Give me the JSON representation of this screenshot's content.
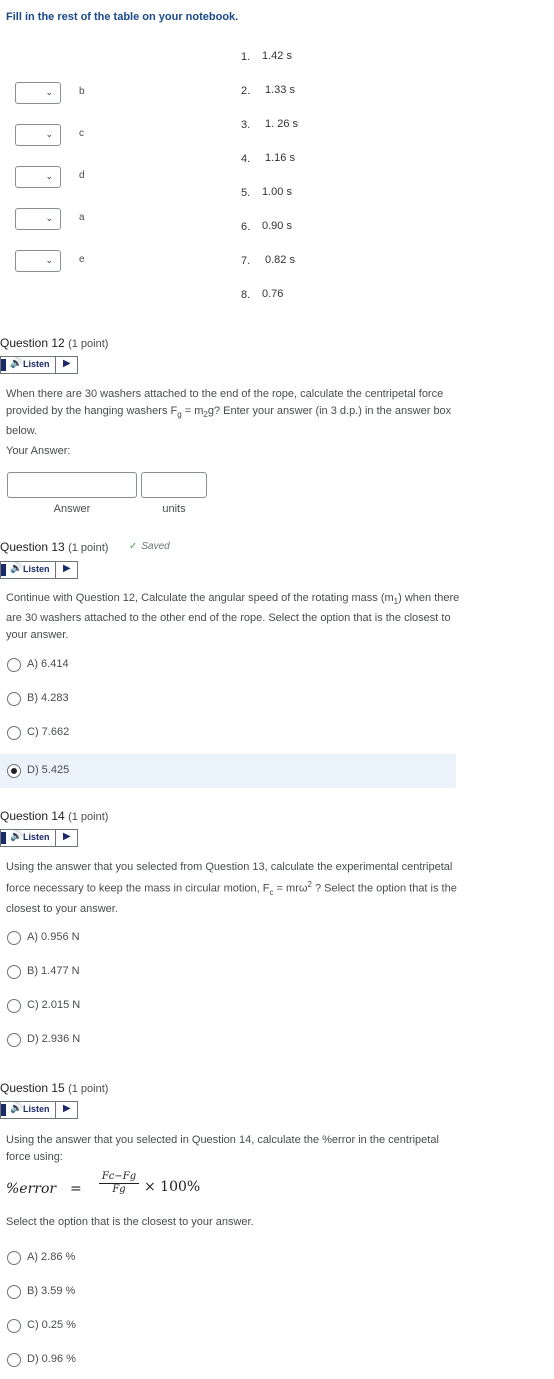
{
  "instruction": "Fill in the rest of the table on your notebook.",
  "matching": {
    "letters": [
      "b",
      "c",
      "d",
      "a",
      "e"
    ],
    "chevron_icon": "chevron-down-icon",
    "items": [
      {
        "num": "1.",
        "value": "1.42 s"
      },
      {
        "num": "2.",
        "value": "1.33 s"
      },
      {
        "num": "3.",
        "value": "1. 26 s"
      },
      {
        "num": "4.",
        "value": "1.16 s"
      },
      {
        "num": "5.",
        "value": "1.00 s"
      },
      {
        "num": "6.",
        "value": "0.90 s"
      },
      {
        "num": "7.",
        "value": "0.82 s"
      },
      {
        "num": "8.",
        "value": "0.76"
      }
    ]
  },
  "listen": {
    "label": "Listen",
    "speaker": "🔊",
    "play": "▶"
  },
  "q12": {
    "title": "Question 12",
    "points": "(1 point)",
    "text_a": "When there are 30 washers attached to the end of the rope, calculate the centripetal force provided by the hanging washers F",
    "sub_g": "g",
    "text_b": " = m",
    "sub_2": "2",
    "text_c": "g? Enter your answer (in 3 d.p.) in the answer box below.",
    "your_answer": "Your Answer:",
    "answer_label": "Answer",
    "units_label": "units"
  },
  "q13": {
    "title": "Question 13",
    "points": "(1 point)",
    "saved": "Saved",
    "text_a": "Continue with Question 12, Calculate the angular speed of the rotating mass (m",
    "sub_1": "1",
    "text_b": ") when there are 30 washers attached to the other end of the rope. Select the option that is the closest to your answer.",
    "options": [
      "A) 6.414",
      "B) 4.283",
      "C) 7.662",
      "D) 5.425"
    ],
    "selected_index": 3
  },
  "q14": {
    "title": "Question 14",
    "points": "(1 point)",
    "text_a": "Using the answer that you selected from Question 13, calculate the experimental centripetal force necessary to keep the mass in circular motion, F",
    "sub_c": "c",
    "text_b": " = mrω",
    "sup_2": "2",
    "text_c": " ? Select the option that is the closest to your answer.",
    "options": [
      "A) 0.956 N",
      "B) 1.477 N",
      "C) 2.015 N",
      "D) 2.936 N"
    ]
  },
  "q15": {
    "title": "Question 15",
    "points": "(1 point)",
    "text": "Using the answer that you selected in Question 14, calculate the %error in the centripetal force using:",
    "formula_lhs": "%error",
    "formula_eq": "=",
    "formula_num": "Fc−Fg",
    "formula_den": "Fg",
    "formula_times": "× 100%",
    "select_text": "Select the option that is the closest to your answer.",
    "options": [
      "A) 2.86 %",
      "B) 3.59 %",
      "C) 0.25 %",
      "D) 0.96 %"
    ]
  }
}
